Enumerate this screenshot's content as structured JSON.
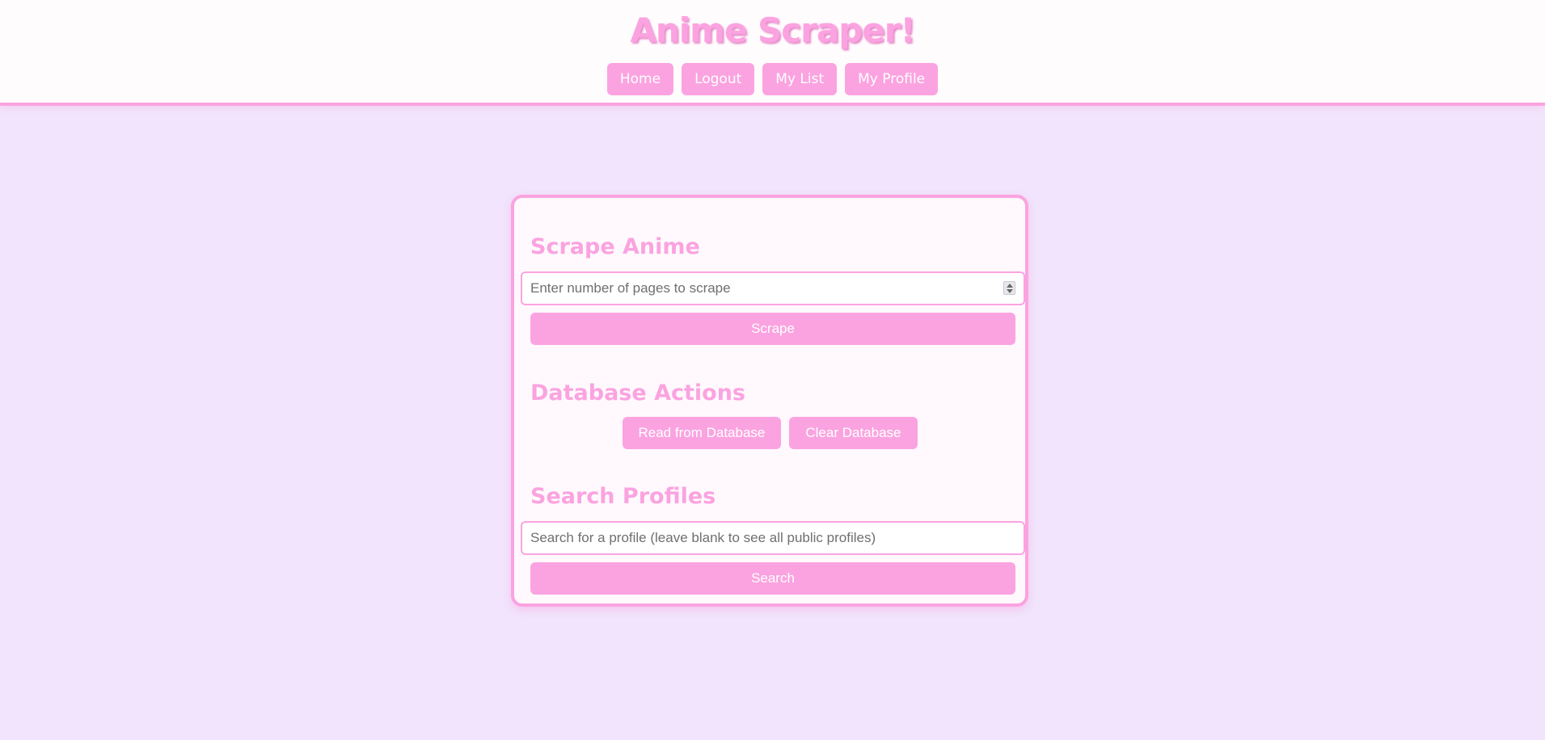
{
  "header": {
    "title": "Anime Scraper!",
    "nav": [
      {
        "label": "Home"
      },
      {
        "label": "Logout"
      },
      {
        "label": "My List"
      },
      {
        "label": "My Profile"
      }
    ]
  },
  "scrape": {
    "title": "Scrape Anime",
    "input_placeholder": "Enter number of pages to scrape",
    "input_value": "",
    "button_label": "Scrape"
  },
  "database": {
    "title": "Database Actions",
    "read_label": "Read from Database",
    "clear_label": "Clear Database"
  },
  "search": {
    "title": "Search Profiles",
    "input_placeholder": "Search for a profile (leave blank to see all public profiles)",
    "input_value": "",
    "button_label": "Search"
  },
  "colors": {
    "accent": "#fba3e0",
    "background": "#f1e4fc",
    "card": "#fff9fd"
  },
  "icons": {
    "number_spinner": "spinner-icon"
  }
}
